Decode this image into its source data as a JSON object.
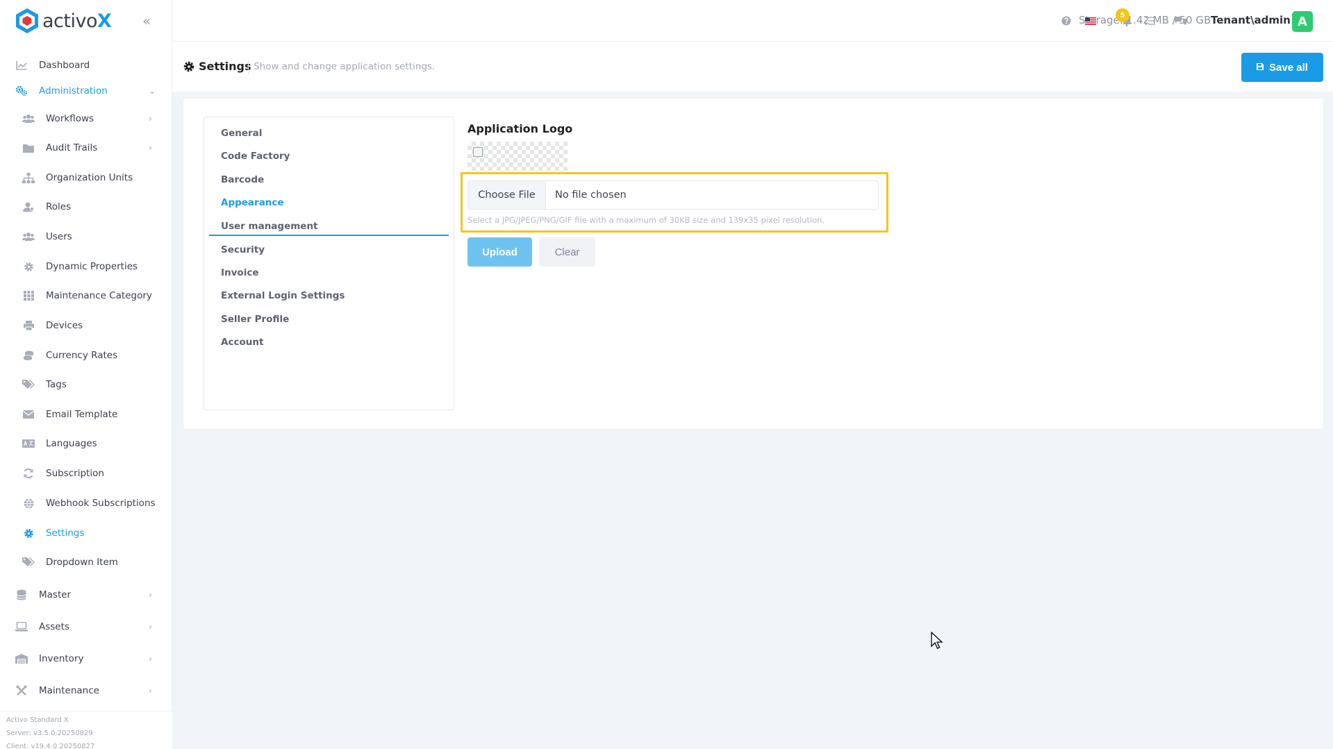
{
  "brand": {
    "name_plain": "activo",
    "name_accent": "X"
  },
  "header": {
    "storage": "Storage: 1.42 MB / 50 GB",
    "notification_count": "5",
    "user": "Tenant\\admin",
    "avatar_letter": "A",
    "icons": [
      "help-icon",
      "us-flag-icon",
      "bell-icon",
      "task-list-icon",
      "chat-icon"
    ]
  },
  "sidebar": {
    "items": [
      {
        "label": "Dashboard",
        "icon": "chart-icon",
        "level": "top"
      },
      {
        "label": "Administration",
        "icon": "cogs-icon",
        "level": "top",
        "active": true,
        "expanded": true
      },
      {
        "label": "Workflows",
        "icon": "users-icon",
        "level": "sub",
        "chevron": true
      },
      {
        "label": "Audit Trails",
        "icon": "folder-icon",
        "level": "sub",
        "chevron": true
      },
      {
        "label": "Organization Units",
        "icon": "sitemap-icon",
        "level": "sub"
      },
      {
        "label": "Roles",
        "icon": "user-role-icon",
        "level": "sub"
      },
      {
        "label": "Users",
        "icon": "users-icon",
        "level": "sub"
      },
      {
        "label": "Dynamic Properties",
        "icon": "gear-icon",
        "level": "sub"
      },
      {
        "label": "Maintenance Category",
        "icon": "grid-icon",
        "level": "sub"
      },
      {
        "label": "Devices",
        "icon": "printer-icon",
        "level": "sub"
      },
      {
        "label": "Currency Rates",
        "icon": "coins-icon",
        "level": "sub"
      },
      {
        "label": "Tags",
        "icon": "tags-icon",
        "level": "sub"
      },
      {
        "label": "Email Template",
        "icon": "envelope-icon",
        "level": "sub"
      },
      {
        "label": "Languages",
        "icon": "language-icon",
        "level": "sub"
      },
      {
        "label": "Subscription",
        "icon": "refresh-icon",
        "level": "sub"
      },
      {
        "label": "Webhook Subscriptions",
        "icon": "globe-icon",
        "level": "sub"
      },
      {
        "label": "Settings",
        "icon": "gear-icon",
        "level": "sub",
        "active": true
      },
      {
        "label": "Dropdown Item",
        "icon": "tags-icon",
        "level": "sub"
      },
      {
        "label": "Master",
        "icon": "database-icon",
        "level": "top",
        "chevron": true
      },
      {
        "label": "Assets",
        "icon": "laptop-icon",
        "level": "top",
        "chevron": true
      },
      {
        "label": "Inventory",
        "icon": "warehouse-icon",
        "level": "top",
        "chevron": true
      },
      {
        "label": "Maintenance",
        "icon": "tools-icon",
        "level": "top",
        "chevron": true
      }
    ],
    "footer": [
      "Activo Standard X",
      "Server: v3.5.0.20250829",
      "Client: v19.4.0.20250827"
    ]
  },
  "subheader": {
    "title": "Settings",
    "description": "Show and change application settings.",
    "save_label": "Save all"
  },
  "settings_tabs": [
    {
      "label": "General"
    },
    {
      "label": "Code Factory"
    },
    {
      "label": "Barcode"
    },
    {
      "label": "Appearance",
      "active": true
    },
    {
      "label": "User management"
    },
    {
      "label": "Security"
    },
    {
      "label": "Invoice"
    },
    {
      "label": "External Login Settings"
    },
    {
      "label": "Seller Profile"
    },
    {
      "label": "Account"
    }
  ],
  "appearance": {
    "logo_title": "Application Logo",
    "choose_file_label": "Choose File",
    "file_status": "No file chosen",
    "help_text": "Select a JPG/JPEG/PNG/GIF file with a maximum of 30KB size and 139x35 pixel resolution.",
    "upload_label": "Upload",
    "clear_label": "Clear"
  },
  "colors": {
    "accent": "#1b9be6",
    "highlight": "#f5c518",
    "avatar": "#2ecc71"
  }
}
